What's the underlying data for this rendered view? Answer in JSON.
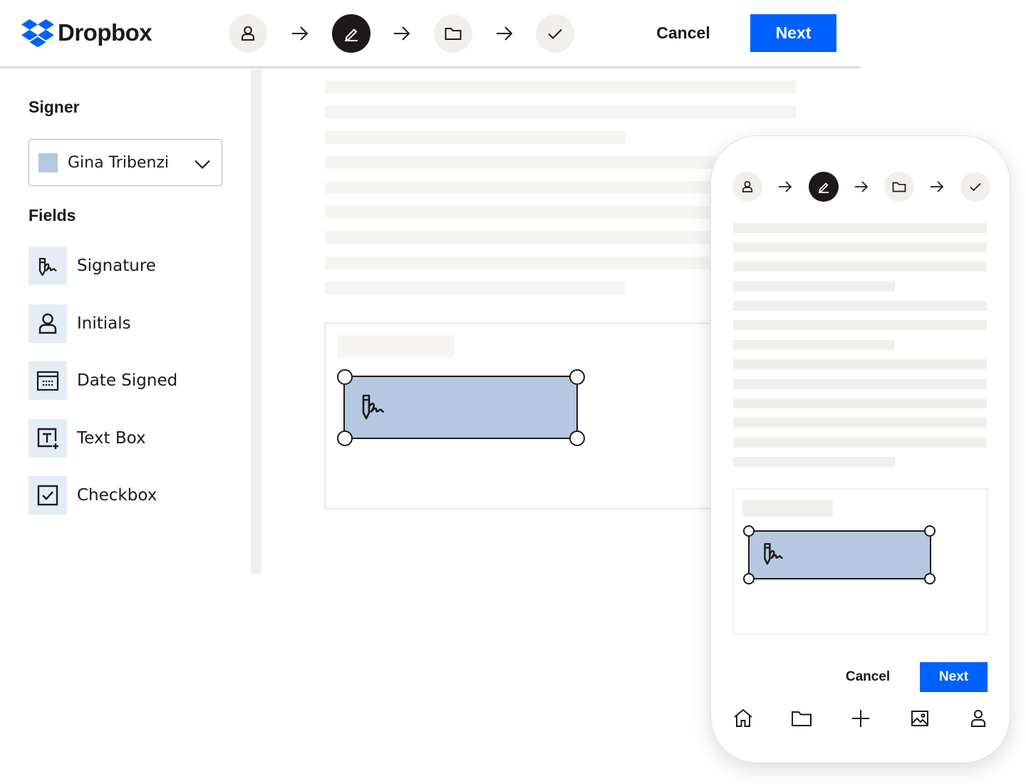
{
  "app": {
    "brand": "Dropbox"
  },
  "header": {
    "steps": [
      {
        "icon": "person-icon",
        "state": "pending"
      },
      {
        "icon": "pen-icon",
        "state": "active"
      },
      {
        "icon": "folder-icon",
        "state": "pending"
      },
      {
        "icon": "check-icon",
        "state": "pending"
      }
    ],
    "cancel_label": "Cancel",
    "next_label": "Next"
  },
  "sidebar": {
    "signer_title": "Signer",
    "signer": {
      "name": "Gina Tribenzi",
      "color": "#b4c8e1"
    },
    "fields_title": "Fields",
    "fields": [
      {
        "label": "Signature",
        "icon": "signature-icon"
      },
      {
        "label": "Initials",
        "icon": "person-icon"
      },
      {
        "label": "Date Signed",
        "icon": "calendar-icon"
      },
      {
        "label": "Text Box",
        "icon": "text-box-icon"
      },
      {
        "label": "Checkbox",
        "icon": "checkbox-icon"
      }
    ]
  },
  "mobile": {
    "cancel_label": "Cancel",
    "next_label": "Next",
    "nav": [
      "home-icon",
      "folder-icon",
      "plus-icon",
      "photo-icon",
      "person-icon"
    ]
  },
  "colors": {
    "accent": "#0061fe",
    "text": "#1e1919",
    "signer_highlight": "#b4c8e1",
    "field_icon_bg": "#e4ecf6",
    "placeholder": "#f1efec"
  }
}
